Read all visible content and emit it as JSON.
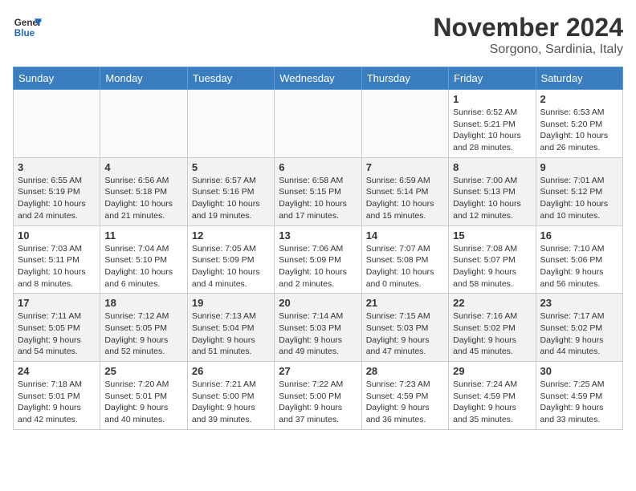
{
  "header": {
    "logo_line1": "General",
    "logo_line2": "Blue",
    "month": "November 2024",
    "location": "Sorgono, Sardinia, Italy"
  },
  "weekdays": [
    "Sunday",
    "Monday",
    "Tuesday",
    "Wednesday",
    "Thursday",
    "Friday",
    "Saturday"
  ],
  "weeks": [
    [
      {
        "day": "",
        "info": ""
      },
      {
        "day": "",
        "info": ""
      },
      {
        "day": "",
        "info": ""
      },
      {
        "day": "",
        "info": ""
      },
      {
        "day": "",
        "info": ""
      },
      {
        "day": "1",
        "info": "Sunrise: 6:52 AM\nSunset: 5:21 PM\nDaylight: 10 hours and 28 minutes."
      },
      {
        "day": "2",
        "info": "Sunrise: 6:53 AM\nSunset: 5:20 PM\nDaylight: 10 hours and 26 minutes."
      }
    ],
    [
      {
        "day": "3",
        "info": "Sunrise: 6:55 AM\nSunset: 5:19 PM\nDaylight: 10 hours and 24 minutes."
      },
      {
        "day": "4",
        "info": "Sunrise: 6:56 AM\nSunset: 5:18 PM\nDaylight: 10 hours and 21 minutes."
      },
      {
        "day": "5",
        "info": "Sunrise: 6:57 AM\nSunset: 5:16 PM\nDaylight: 10 hours and 19 minutes."
      },
      {
        "day": "6",
        "info": "Sunrise: 6:58 AM\nSunset: 5:15 PM\nDaylight: 10 hours and 17 minutes."
      },
      {
        "day": "7",
        "info": "Sunrise: 6:59 AM\nSunset: 5:14 PM\nDaylight: 10 hours and 15 minutes."
      },
      {
        "day": "8",
        "info": "Sunrise: 7:00 AM\nSunset: 5:13 PM\nDaylight: 10 hours and 12 minutes."
      },
      {
        "day": "9",
        "info": "Sunrise: 7:01 AM\nSunset: 5:12 PM\nDaylight: 10 hours and 10 minutes."
      }
    ],
    [
      {
        "day": "10",
        "info": "Sunrise: 7:03 AM\nSunset: 5:11 PM\nDaylight: 10 hours and 8 minutes."
      },
      {
        "day": "11",
        "info": "Sunrise: 7:04 AM\nSunset: 5:10 PM\nDaylight: 10 hours and 6 minutes."
      },
      {
        "day": "12",
        "info": "Sunrise: 7:05 AM\nSunset: 5:09 PM\nDaylight: 10 hours and 4 minutes."
      },
      {
        "day": "13",
        "info": "Sunrise: 7:06 AM\nSunset: 5:09 PM\nDaylight: 10 hours and 2 minutes."
      },
      {
        "day": "14",
        "info": "Sunrise: 7:07 AM\nSunset: 5:08 PM\nDaylight: 10 hours and 0 minutes."
      },
      {
        "day": "15",
        "info": "Sunrise: 7:08 AM\nSunset: 5:07 PM\nDaylight: 9 hours and 58 minutes."
      },
      {
        "day": "16",
        "info": "Sunrise: 7:10 AM\nSunset: 5:06 PM\nDaylight: 9 hours and 56 minutes."
      }
    ],
    [
      {
        "day": "17",
        "info": "Sunrise: 7:11 AM\nSunset: 5:05 PM\nDaylight: 9 hours and 54 minutes."
      },
      {
        "day": "18",
        "info": "Sunrise: 7:12 AM\nSunset: 5:05 PM\nDaylight: 9 hours and 52 minutes."
      },
      {
        "day": "19",
        "info": "Sunrise: 7:13 AM\nSunset: 5:04 PM\nDaylight: 9 hours and 51 minutes."
      },
      {
        "day": "20",
        "info": "Sunrise: 7:14 AM\nSunset: 5:03 PM\nDaylight: 9 hours and 49 minutes."
      },
      {
        "day": "21",
        "info": "Sunrise: 7:15 AM\nSunset: 5:03 PM\nDaylight: 9 hours and 47 minutes."
      },
      {
        "day": "22",
        "info": "Sunrise: 7:16 AM\nSunset: 5:02 PM\nDaylight: 9 hours and 45 minutes."
      },
      {
        "day": "23",
        "info": "Sunrise: 7:17 AM\nSunset: 5:02 PM\nDaylight: 9 hours and 44 minutes."
      }
    ],
    [
      {
        "day": "24",
        "info": "Sunrise: 7:18 AM\nSunset: 5:01 PM\nDaylight: 9 hours and 42 minutes."
      },
      {
        "day": "25",
        "info": "Sunrise: 7:20 AM\nSunset: 5:01 PM\nDaylight: 9 hours and 40 minutes."
      },
      {
        "day": "26",
        "info": "Sunrise: 7:21 AM\nSunset: 5:00 PM\nDaylight: 9 hours and 39 minutes."
      },
      {
        "day": "27",
        "info": "Sunrise: 7:22 AM\nSunset: 5:00 PM\nDaylight: 9 hours and 37 minutes."
      },
      {
        "day": "28",
        "info": "Sunrise: 7:23 AM\nSunset: 4:59 PM\nDaylight: 9 hours and 36 minutes."
      },
      {
        "day": "29",
        "info": "Sunrise: 7:24 AM\nSunset: 4:59 PM\nDaylight: 9 hours and 35 minutes."
      },
      {
        "day": "30",
        "info": "Sunrise: 7:25 AM\nSunset: 4:59 PM\nDaylight: 9 hours and 33 minutes."
      }
    ]
  ]
}
